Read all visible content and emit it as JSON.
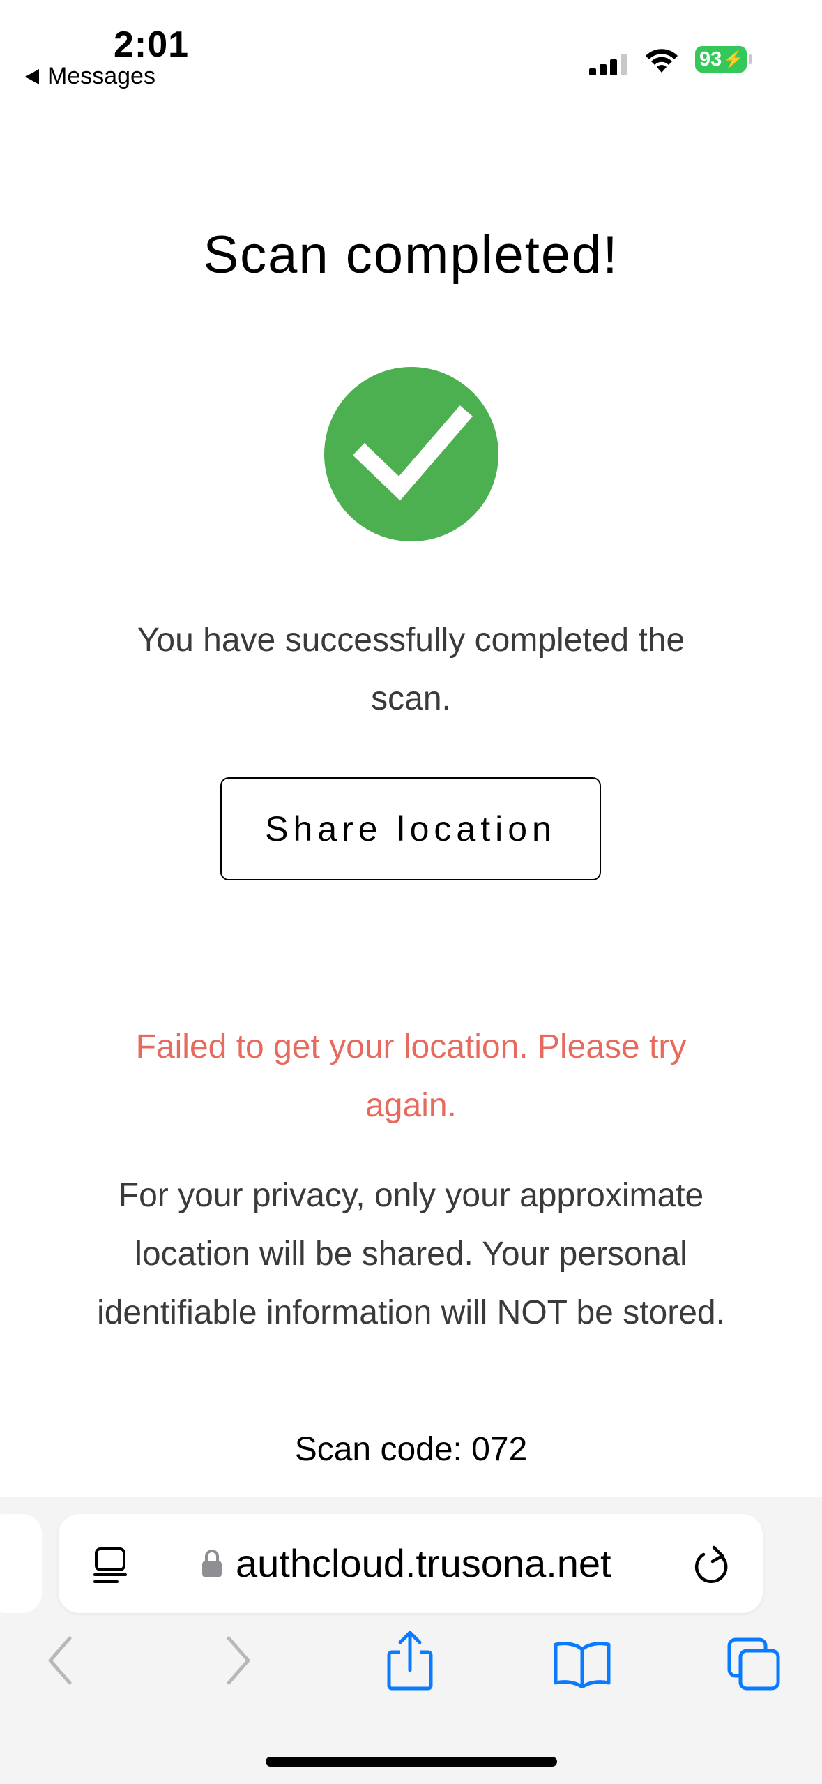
{
  "status_bar": {
    "time": "2:01",
    "back_label": "Messages",
    "battery": "93"
  },
  "page": {
    "title": "Scan completed!",
    "success_message": "You have successfully completed the scan.",
    "share_button_label": "Share location",
    "error_message": "Failed to get your location. Please try again.",
    "privacy_note": "For your privacy, only your approximate location will be shared. Your personal identifiable information will NOT be stored.",
    "scan_code": "Scan code: 072"
  },
  "browser": {
    "url": "authcloud.trusona.net"
  },
  "colors": {
    "success_green": "#4caf50",
    "error_red": "#e66a5e",
    "ios_blue": "#0a7aff",
    "battery_green": "#34c759"
  },
  "icons": [
    "back-arrow-icon",
    "cellular-signal-icon",
    "wifi-icon",
    "battery-icon",
    "checkmark-icon",
    "reader-mode-icon",
    "lock-icon",
    "reload-icon",
    "back-icon",
    "forward-icon",
    "share-icon",
    "bookmarks-icon",
    "tabs-icon"
  ]
}
